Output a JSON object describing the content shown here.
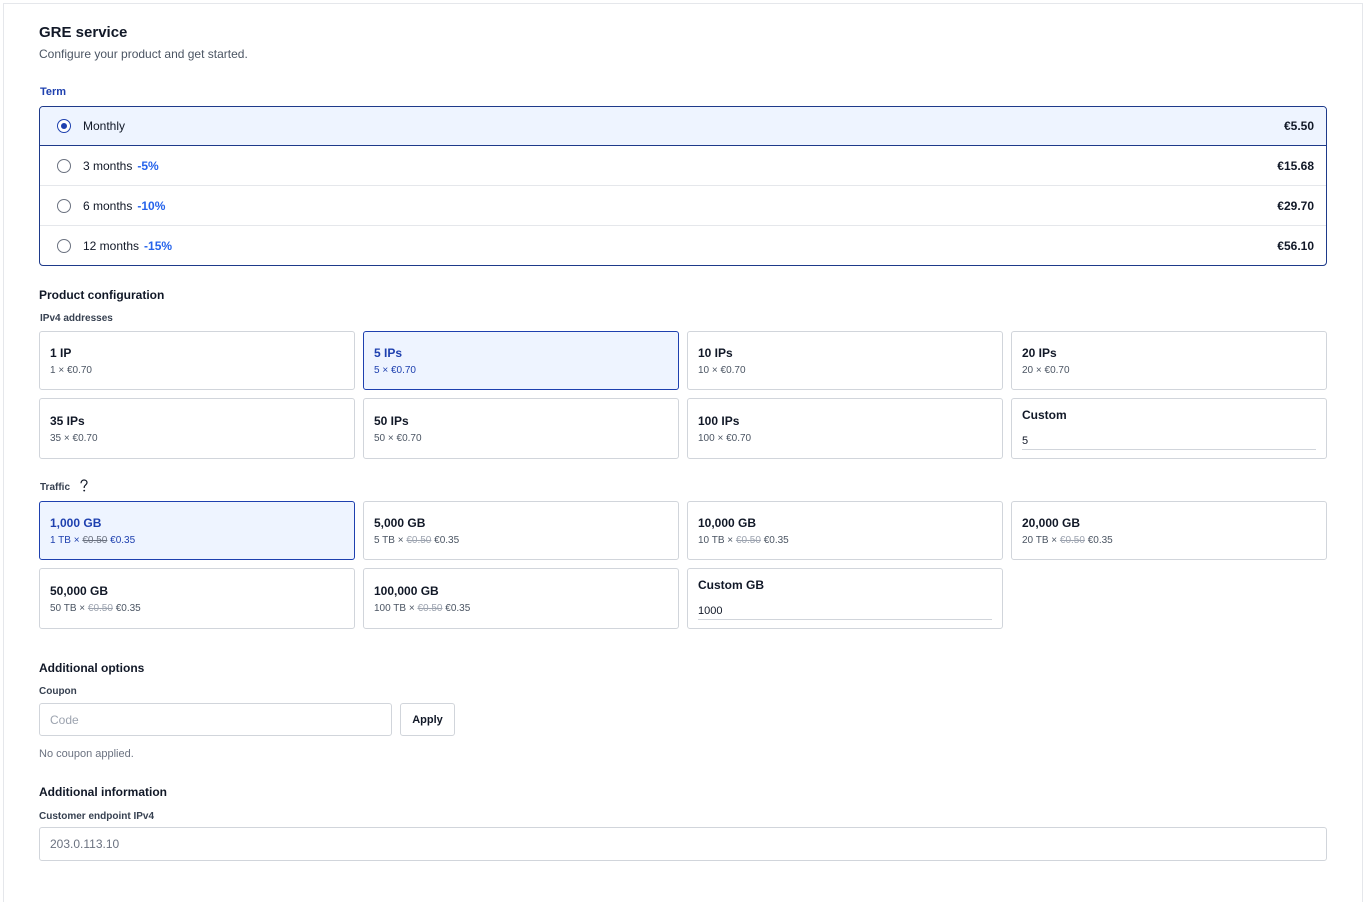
{
  "header": {
    "title": "GRE service",
    "subtitle": "Configure your product and get started."
  },
  "term": {
    "label": "Term",
    "options": [
      {
        "name": "Monthly",
        "discount": "",
        "price": "€5.50",
        "selected": true
      },
      {
        "name": "3 months",
        "discount": "-5%",
        "price": "€15.68",
        "selected": false
      },
      {
        "name": "6 months",
        "discount": "-10%",
        "price": "€29.70",
        "selected": false
      },
      {
        "name": "12 months",
        "discount": "-15%",
        "price": "€56.10",
        "selected": false
      }
    ]
  },
  "product_config": {
    "title": "Product configuration",
    "ipv4": {
      "label": "IPv4 addresses",
      "options": [
        {
          "title": "1 IP",
          "sub": "1 × €0.70"
        },
        {
          "title": "5 IPs",
          "sub": "5 × €0.70"
        },
        {
          "title": "10 IPs",
          "sub": "10 × €0.70"
        },
        {
          "title": "20 IPs",
          "sub": "20 × €0.70"
        },
        {
          "title": "35 IPs",
          "sub": "35 × €0.70"
        },
        {
          "title": "50 IPs",
          "sub": "50 × €0.70"
        },
        {
          "title": "100 IPs",
          "sub": "100 × €0.70"
        }
      ],
      "selected_index": 1,
      "custom": {
        "title": "Custom",
        "value": "5"
      }
    },
    "traffic": {
      "label": "Traffic",
      "help_icon": "question-mark-icon",
      "options": [
        {
          "title": "1,000 GB",
          "prefix": "1 TB ×",
          "old_price": "€0.50",
          "price": "€0.35"
        },
        {
          "title": "5,000 GB",
          "prefix": "5 TB ×",
          "old_price": "€0.50",
          "price": "€0.35"
        },
        {
          "title": "10,000 GB",
          "prefix": "10 TB ×",
          "old_price": "€0.50",
          "price": "€0.35"
        },
        {
          "title": "20,000 GB",
          "prefix": "20 TB ×",
          "old_price": "€0.50",
          "price": "€0.35"
        },
        {
          "title": "50,000 GB",
          "prefix": "50 TB ×",
          "old_price": "€0.50",
          "price": "€0.35"
        },
        {
          "title": "100,000 GB",
          "prefix": "100 TB ×",
          "old_price": "€0.50",
          "price": "€0.35"
        }
      ],
      "selected_index": 0,
      "custom": {
        "title": "Custom GB",
        "value": "1000"
      }
    }
  },
  "additional_options": {
    "title": "Additional options",
    "coupon_label": "Coupon",
    "coupon_placeholder": "Code",
    "apply_label": "Apply",
    "coupon_status": "No coupon applied."
  },
  "additional_info": {
    "title": "Additional information",
    "endpoint_label": "Customer endpoint IPv4",
    "endpoint_placeholder": "203.0.113.10"
  },
  "colors": {
    "accent": "#1e40af",
    "selected_bg": "#eef4ff",
    "discount": "#2563eb"
  }
}
